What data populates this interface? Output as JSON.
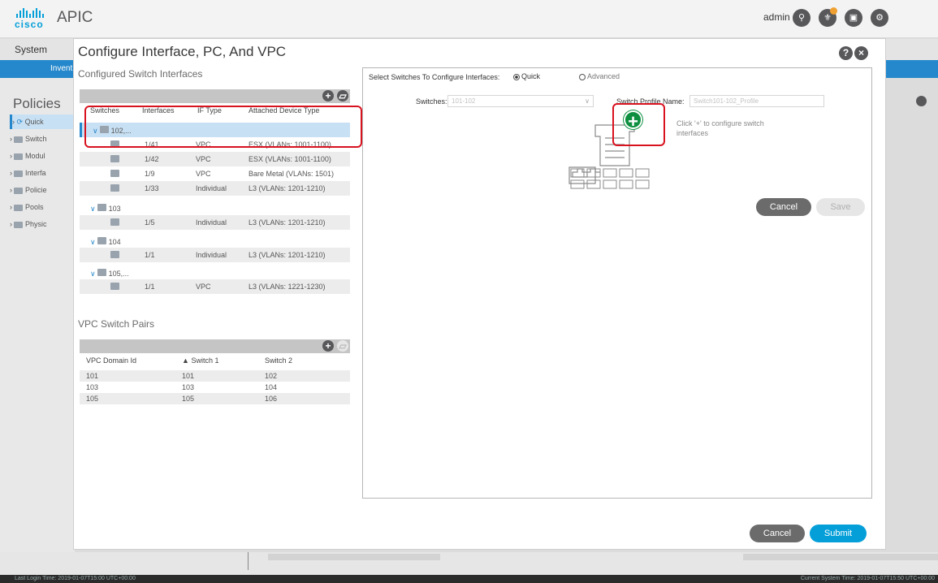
{
  "app": {
    "logo_text": "cisco",
    "title": "APIC",
    "user": "admin"
  },
  "menu": {
    "system": "System",
    "sub_item": "Invent"
  },
  "left": {
    "heading": "Policies",
    "items": [
      {
        "label": "Quick",
        "icon": "quick-start-icon"
      },
      {
        "label": "Switch",
        "icon": "folder-icon"
      },
      {
        "label": "Modul",
        "icon": "folder-icon"
      },
      {
        "label": "Interfa",
        "icon": "folder-icon"
      },
      {
        "label": "Policie",
        "icon": "folder-icon"
      },
      {
        "label": "Pools",
        "icon": "folder-icon"
      },
      {
        "label": "Physic",
        "icon": "folder-icon"
      }
    ]
  },
  "dialog": {
    "title": "Configure Interface, PC, And VPC",
    "configured_title": "Configured Switch Interfaces",
    "columns": [
      "Switches",
      "Interfaces",
      "IF Type",
      "Attached Device Type"
    ],
    "rows": [
      {
        "kind": "group",
        "switch": "102,..."
      },
      {
        "kind": "item",
        "interface": "1/41",
        "if_type": "VPC",
        "device": "ESX (VLANs: 1001-1100)"
      },
      {
        "kind": "item",
        "interface": "1/42",
        "if_type": "VPC",
        "device": "ESX (VLANs: 1001-1100)"
      },
      {
        "kind": "item",
        "interface": "1/9",
        "if_type": "VPC",
        "device": "Bare Metal (VLANs: 1501)"
      },
      {
        "kind": "item",
        "interface": "1/33",
        "if_type": "Individual",
        "device": "L3 (VLANs: 1201-1210)"
      },
      {
        "kind": "group",
        "switch": "103"
      },
      {
        "kind": "item",
        "interface": "1/5",
        "if_type": "Individual",
        "device": "L3 (VLANs: 1201-1210)"
      },
      {
        "kind": "group",
        "switch": "104"
      },
      {
        "kind": "item",
        "interface": "1/1",
        "if_type": "Individual",
        "device": "L3 (VLANs: 1201-1210)"
      },
      {
        "kind": "group",
        "switch": "105,..."
      },
      {
        "kind": "item",
        "interface": "1/1",
        "if_type": "VPC",
        "device": "L3 (VLANs: 1221-1230)"
      }
    ],
    "vpc_title": "VPC Switch Pairs",
    "vpc_columns": [
      "VPC Domain Id",
      "Switch 1",
      "Switch 2"
    ],
    "vpc_rows": [
      [
        "101",
        "101",
        "102"
      ],
      [
        "103",
        "103",
        "104"
      ],
      [
        "105",
        "105",
        "106"
      ]
    ],
    "select_label": "Select Switches To Configure Interfaces:",
    "quick": "Quick",
    "advanced": "Advanced",
    "switches_label": "Switches:",
    "switches_value": "101-102",
    "profile_label": "Switch Profile Name:",
    "profile_value": "Switch101-102_Profile",
    "hint": "Click '+' to configure switch interfaces",
    "cancel": "Cancel",
    "save": "Save",
    "footer_cancel": "Cancel",
    "submit": "Submit"
  },
  "footer": {
    "last_login": "Last Login Time: 2019-01-07T15:00 UTC+00:00",
    "current_time": "Current System Time: 2019-01-07T15:50 UTC+00:00"
  },
  "colors": {
    "accent": "#049fd9",
    "selection": "#c8e0f3",
    "highlight": "#d8121f",
    "add": "#0d8f3f"
  }
}
